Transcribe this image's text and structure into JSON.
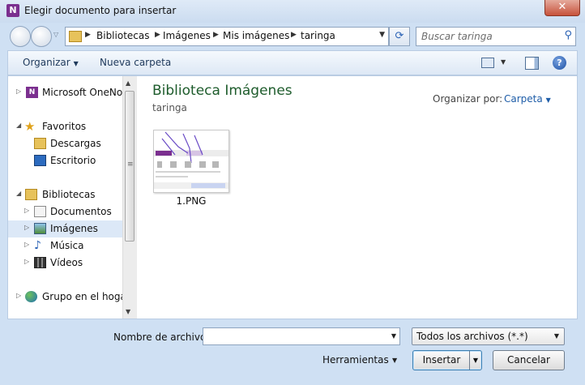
{
  "window": {
    "title": "Elegir documento para insertar",
    "close_label": "✕"
  },
  "address": {
    "crumbs": [
      "Bibliotecas",
      "Imágenes",
      "Mis imágenes",
      "taringa"
    ],
    "search_placeholder": "Buscar taringa"
  },
  "toolbar": {
    "organize_label": "Organizar",
    "new_folder_label": "Nueva carpeta",
    "help_label": "?"
  },
  "nav": {
    "items": [
      {
        "label": "Microsoft OneNote",
        "icon": "onenote-icon"
      },
      {
        "label": "Favoritos",
        "icon": "star-icon"
      },
      {
        "label": "Descargas",
        "icon": "downloads-folder-icon"
      },
      {
        "label": "Escritorio",
        "icon": "desktop-icon"
      },
      {
        "label": "Bibliotecas",
        "icon": "libraries-icon"
      },
      {
        "label": "Documentos",
        "icon": "documents-icon"
      },
      {
        "label": "Imágenes",
        "icon": "pictures-icon",
        "selected": true
      },
      {
        "label": "Música",
        "icon": "music-icon"
      },
      {
        "label": "Vídeos",
        "icon": "videos-icon"
      },
      {
        "label": "Grupo en el hogar",
        "icon": "homegroup-icon"
      }
    ]
  },
  "main": {
    "library_title": "Biblioteca Imágenes",
    "library_subtitle": "taringa",
    "arrange_label": "Organizar por:",
    "arrange_value": "Carpeta",
    "files": [
      {
        "name": "1.PNG"
      }
    ]
  },
  "footer": {
    "filename_label": "Nombre de archivo:",
    "filename_value": "",
    "filetype_value": "Todos los archivos (*.*)",
    "tools_label": "Herramientas",
    "insert_label": "Insertar",
    "cancel_label": "Cancelar"
  },
  "colors": {
    "library_title": "#1e5c2c",
    "link_blue": "#1e5da8",
    "selection": "#dce8f7"
  }
}
